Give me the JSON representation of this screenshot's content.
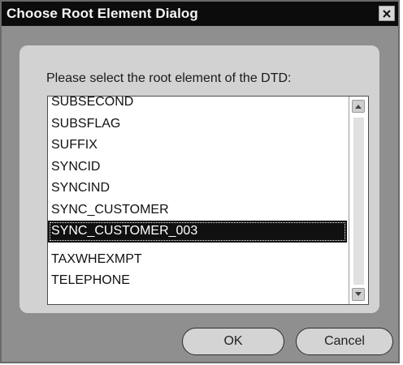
{
  "dialog": {
    "title": "Choose Root Element Dialog",
    "close_symbol": "✕",
    "prompt": "Please select the root element of the DTD:"
  },
  "root_element_list": {
    "items": [
      {
        "label": "SUBSECOND"
      },
      {
        "label": "SUBSFLAG"
      },
      {
        "label": "SUFFIX"
      },
      {
        "label": "SYNCID"
      },
      {
        "label": "SYNCIND"
      },
      {
        "label": "SYNC_CUSTOMER"
      },
      {
        "label": "SYNC_CUSTOMER_003",
        "selected": true
      },
      {
        "label": "TAXWHEXMPT"
      },
      {
        "label": "TELEPHONE"
      }
    ],
    "selected_value": "SYNC_CUSTOMER_003"
  },
  "buttons": {
    "ok": "OK",
    "cancel": "Cancel"
  },
  "icons": {
    "close": "close-icon",
    "scroll_up": "scroll-up-icon",
    "scroll_down": "scroll-down-icon"
  }
}
